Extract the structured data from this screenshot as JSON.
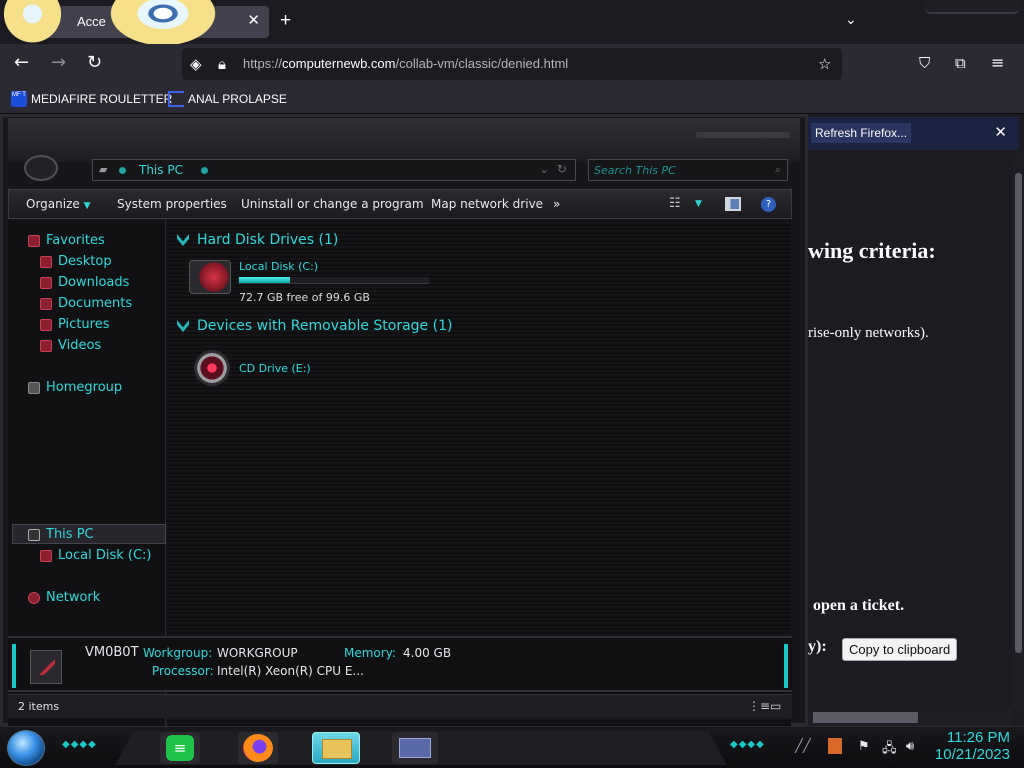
{
  "browser": {
    "tab_title": "Acce",
    "new_tab": "+",
    "url_host": "computernewb.com",
    "url_rest": "/collab-vm/classic/denied.html",
    "url_scheme": "https://",
    "bookmarks": [
      {
        "label": "MEDIAFIRE ROULETTER",
        "icon_text": "MF T"
      },
      {
        "label": "ANAL PROLAPSE"
      }
    ],
    "notification_button": "Refresh Firefox..."
  },
  "page": {
    "heading_fragment": "wing criteria:",
    "paragraph_fragment": "rise-only networks).",
    "ticket_fragment": "open a ticket.",
    "key_fragment": "y):",
    "copy_button": "Copy to clipboard"
  },
  "explorer": {
    "address": "This PC",
    "search_placeholder": "Search This PC",
    "commands": [
      "Organize",
      "System properties",
      "Uninstall or change a program",
      "Map network drive",
      "»"
    ],
    "nav": {
      "favorites": "Favorites",
      "desktop": "Desktop",
      "downloads": "Downloads",
      "documents": "Documents",
      "pictures": "Pictures",
      "videos": "Videos",
      "homegroup": "Homegroup",
      "this_pc": "This PC",
      "local_disk": "Local Disk (C:)",
      "network": "Network"
    },
    "groups": {
      "hdd": "Hard Disk Drives (1)",
      "removable": "Devices with Removable Storage (1)"
    },
    "drive_c": {
      "name": "Local Disk (C:)",
      "free_text": "72.7 GB free of 99.6 GB",
      "used_fraction": 0.27
    },
    "drive_e": {
      "name": "CD Drive (E:)"
    },
    "details": {
      "computer_name": "VM0B0T",
      "workgroup_label": "Workgroup:",
      "workgroup_value": "WORKGROUP",
      "memory_label": "Memory:",
      "memory_value": "4.00 GB",
      "processor_label": "Processor:",
      "processor_value": "Intel(R) Xeon(R) CPU E..."
    },
    "status_text": "2 items"
  },
  "taskbar": {
    "time": "11:26 PM",
    "date": "10/21/2023"
  },
  "colors": {
    "accent": "#2fd9d9",
    "browser_bg": "#1c1b22",
    "toolbar_bg": "#2b2a33"
  }
}
